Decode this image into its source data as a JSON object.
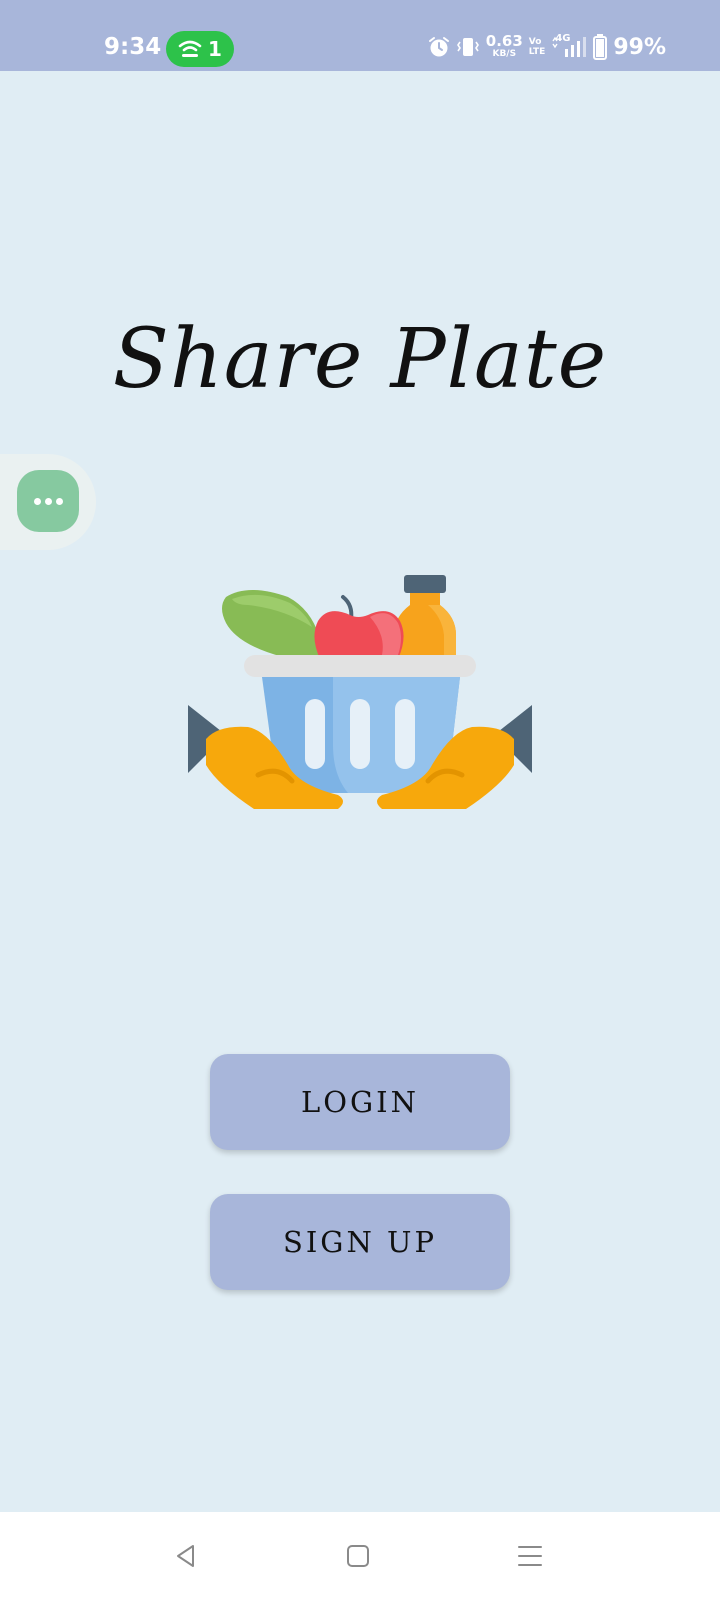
{
  "status_bar": {
    "time": "9:34",
    "hotspot_count": "1",
    "net_speed_value": "0.63",
    "net_speed_unit": "KB/S",
    "volte_top": "Vo",
    "volte_bottom": "LTE",
    "network_type": "4G",
    "battery_percent": "99%",
    "icons": [
      "hotspot-icon",
      "alarm-icon",
      "vibrate-icon",
      "signal-icon",
      "battery-icon"
    ]
  },
  "app": {
    "title": "Share Plate"
  },
  "floating_button": {
    "icon": "more-dots-icon",
    "color": "#86c9a0"
  },
  "illustration": {
    "icon": "grocery-basket-hands-icon"
  },
  "actions": {
    "login_label": "LOGIN",
    "signup_label": "SIGN UP",
    "button_color": "#a8b6da"
  },
  "nav_bar": {
    "icons": [
      "back-icon",
      "home-icon",
      "recents-icon"
    ]
  },
  "colors": {
    "background": "#e0edf4",
    "status_bar": "#a8b6da",
    "hotspot_pill": "#2dc24a"
  }
}
